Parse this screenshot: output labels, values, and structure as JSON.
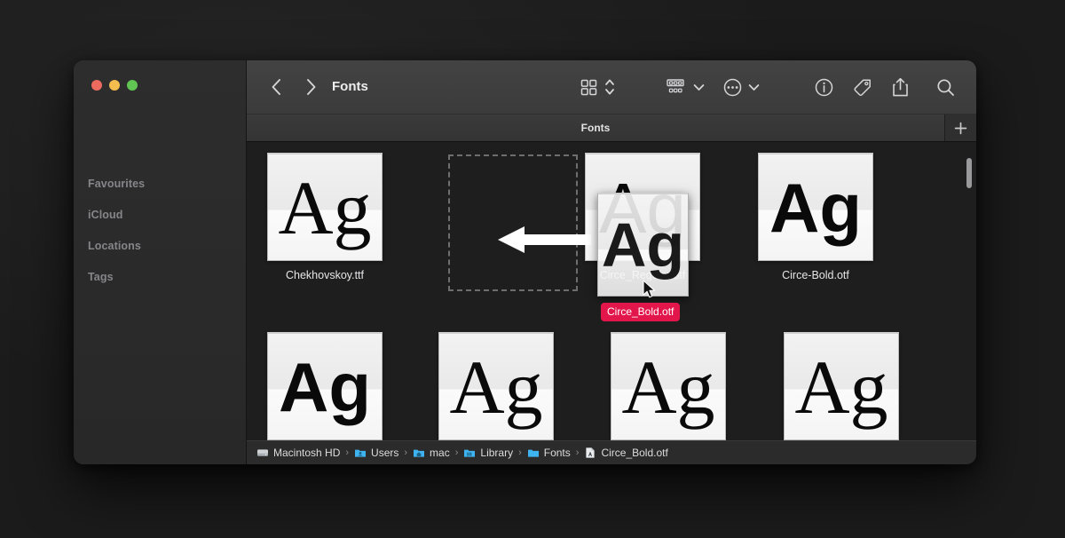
{
  "window": {
    "traffic_lights": [
      "close",
      "minimize",
      "zoom"
    ],
    "colors": {
      "close": "#ed6a5f",
      "minimize": "#f4bd4f",
      "zoom": "#61c554",
      "drag_badge": "#e2164b",
      "desktop_bg": "#1b1b1b",
      "sidebar_bg": "#2a2a2a",
      "content_bg": "#1e1e1e"
    }
  },
  "sidebar": {
    "items": [
      {
        "label": "Favourites",
        "icon": "folder-group-icon"
      },
      {
        "label": "iCloud",
        "icon": "cloud-group-icon"
      },
      {
        "label": "Locations",
        "icon": "disk-group-icon"
      },
      {
        "label": "Tags",
        "icon": "tag-group-icon"
      }
    ]
  },
  "toolbar": {
    "title": "Fonts",
    "back_icon": "chevron-left-icon",
    "forward_icon": "chevron-right-icon",
    "view_grid_icon": "grid-view-icon",
    "view_chevrons_icon": "chevron-up-down-icon",
    "group_icon": "group-by-icon",
    "group_chevron_icon": "chevron-down-icon",
    "more_icon": "ellipsis-circle-icon",
    "more_chevron_icon": "chevron-down-icon",
    "info_icon": "info-circle-icon",
    "tag_icon": "tag-icon",
    "share_icon": "share-icon",
    "search_icon": "search-icon"
  },
  "tabbar": {
    "active_tab": "Fonts",
    "new_tab_label": "+",
    "new_tab_icon": "plus-icon"
  },
  "files": {
    "row1": [
      {
        "label": "Chekhovskoy.ttf",
        "preview_text": "Ag",
        "style": "serif"
      },
      {
        "label": "Circe_Regular.otf",
        "preview_text": "Ag",
        "style": "sans-light"
      },
      {
        "label": "Circe-Bold.otf",
        "preview_text": "Ag",
        "style": "sans-bold"
      }
    ],
    "row2": [
      {
        "label": "",
        "preview_text": "Ag",
        "style": "sans-bold"
      },
      {
        "label": "",
        "preview_text": "Ag",
        "style": "serif"
      },
      {
        "label": "",
        "preview_text": "Ag",
        "style": "serif"
      },
      {
        "label": "",
        "preview_text": "Ag",
        "style": "serif"
      }
    ]
  },
  "drag": {
    "ghost_preview_text": "Ag",
    "badge_label": "Circe_Bold.otf",
    "cursor_icon": "arrow-cursor-icon",
    "arrow_annotation_icon": "left-arrow-annotation-icon",
    "drop_target_name": "empty-grid-slot"
  },
  "pathbar": {
    "crumbs": [
      {
        "label": "Macintosh HD",
        "icon": "hard-drive-icon"
      },
      {
        "label": "Users",
        "icon": "users-folder-icon"
      },
      {
        "label": "mac",
        "icon": "home-folder-icon"
      },
      {
        "label": "Library",
        "icon": "library-folder-icon"
      },
      {
        "label": "Fonts",
        "icon": "folder-icon"
      },
      {
        "label": "Circe_Bold.otf",
        "icon": "font-file-icon"
      }
    ],
    "separator": "›"
  }
}
